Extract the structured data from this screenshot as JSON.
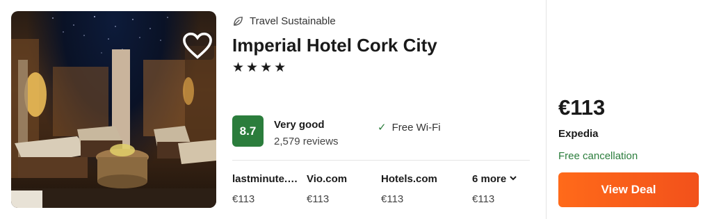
{
  "listing": {
    "sustainability_label": "Travel Sustainable",
    "hotel_name": "Imperial Hotel Cork City",
    "star_count": 4,
    "stars_display": "★★★★",
    "rating": {
      "score": "8.7",
      "label": "Very good",
      "reviews": "2,579 reviews",
      "color": "#2b7d3c"
    },
    "amenities": [
      {
        "icon": "check-icon",
        "label": "Free Wi-Fi"
      }
    ],
    "favorite_icon": "heart-outline-icon",
    "photo_alt": "Hotel spa relaxation room"
  },
  "providers": [
    {
      "name": "lastminute.com",
      "price": "€113"
    },
    {
      "name": "Vio.com",
      "price": "€113"
    },
    {
      "name": "Hotels.com",
      "price": "€113"
    }
  ],
  "more_providers": {
    "label": "6 more",
    "price": "€113",
    "icon": "chevron-down-icon"
  },
  "deal": {
    "price": "€113",
    "vendor": "Expedia",
    "cancellation": "Free cancellation",
    "button_label": "View Deal",
    "button_color": "#f2511b",
    "cancellation_color": "#2b7d3c"
  }
}
